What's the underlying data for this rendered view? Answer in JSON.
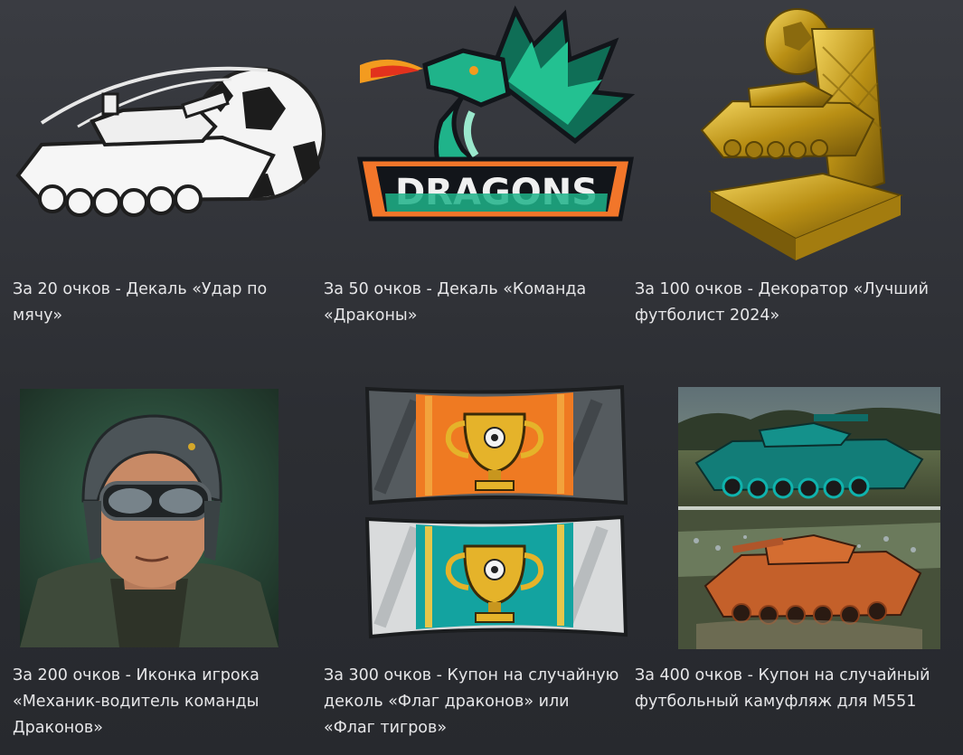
{
  "rewards": [
    {
      "caption": "За 20 очков - Декаль «Удар по мячу»",
      "image": "tank-football-decal"
    },
    {
      "caption": "За 50 очков - Декаль «Команда «Драконы»",
      "image": "dragons-team-decal",
      "logo_text": "DRAGONS"
    },
    {
      "caption": "За 100 очков - Декоратор «Лучший футболист 2024»",
      "image": "golden-tank-trophy"
    },
    {
      "caption": "За 200 очков - Иконка игрока «Механик-водитель команды Драконов»",
      "image": "tank-driver-portrait"
    },
    {
      "caption": "За 300 очков - Купон на случайную деколь «Флаг драконов» или «Флаг тигров»",
      "image": "team-flags"
    },
    {
      "caption": "За 400 очков - Купон на случайный футбольный камуфляж для M551",
      "image": "m551-camouflage"
    }
  ],
  "colors": {
    "background": "#2f3136",
    "text": "#e6e6e8",
    "dragon_green": "#1fb38a",
    "dragon_orange": "#f2762a",
    "gold": "#c9a227",
    "teal": "#12a4a0"
  }
}
